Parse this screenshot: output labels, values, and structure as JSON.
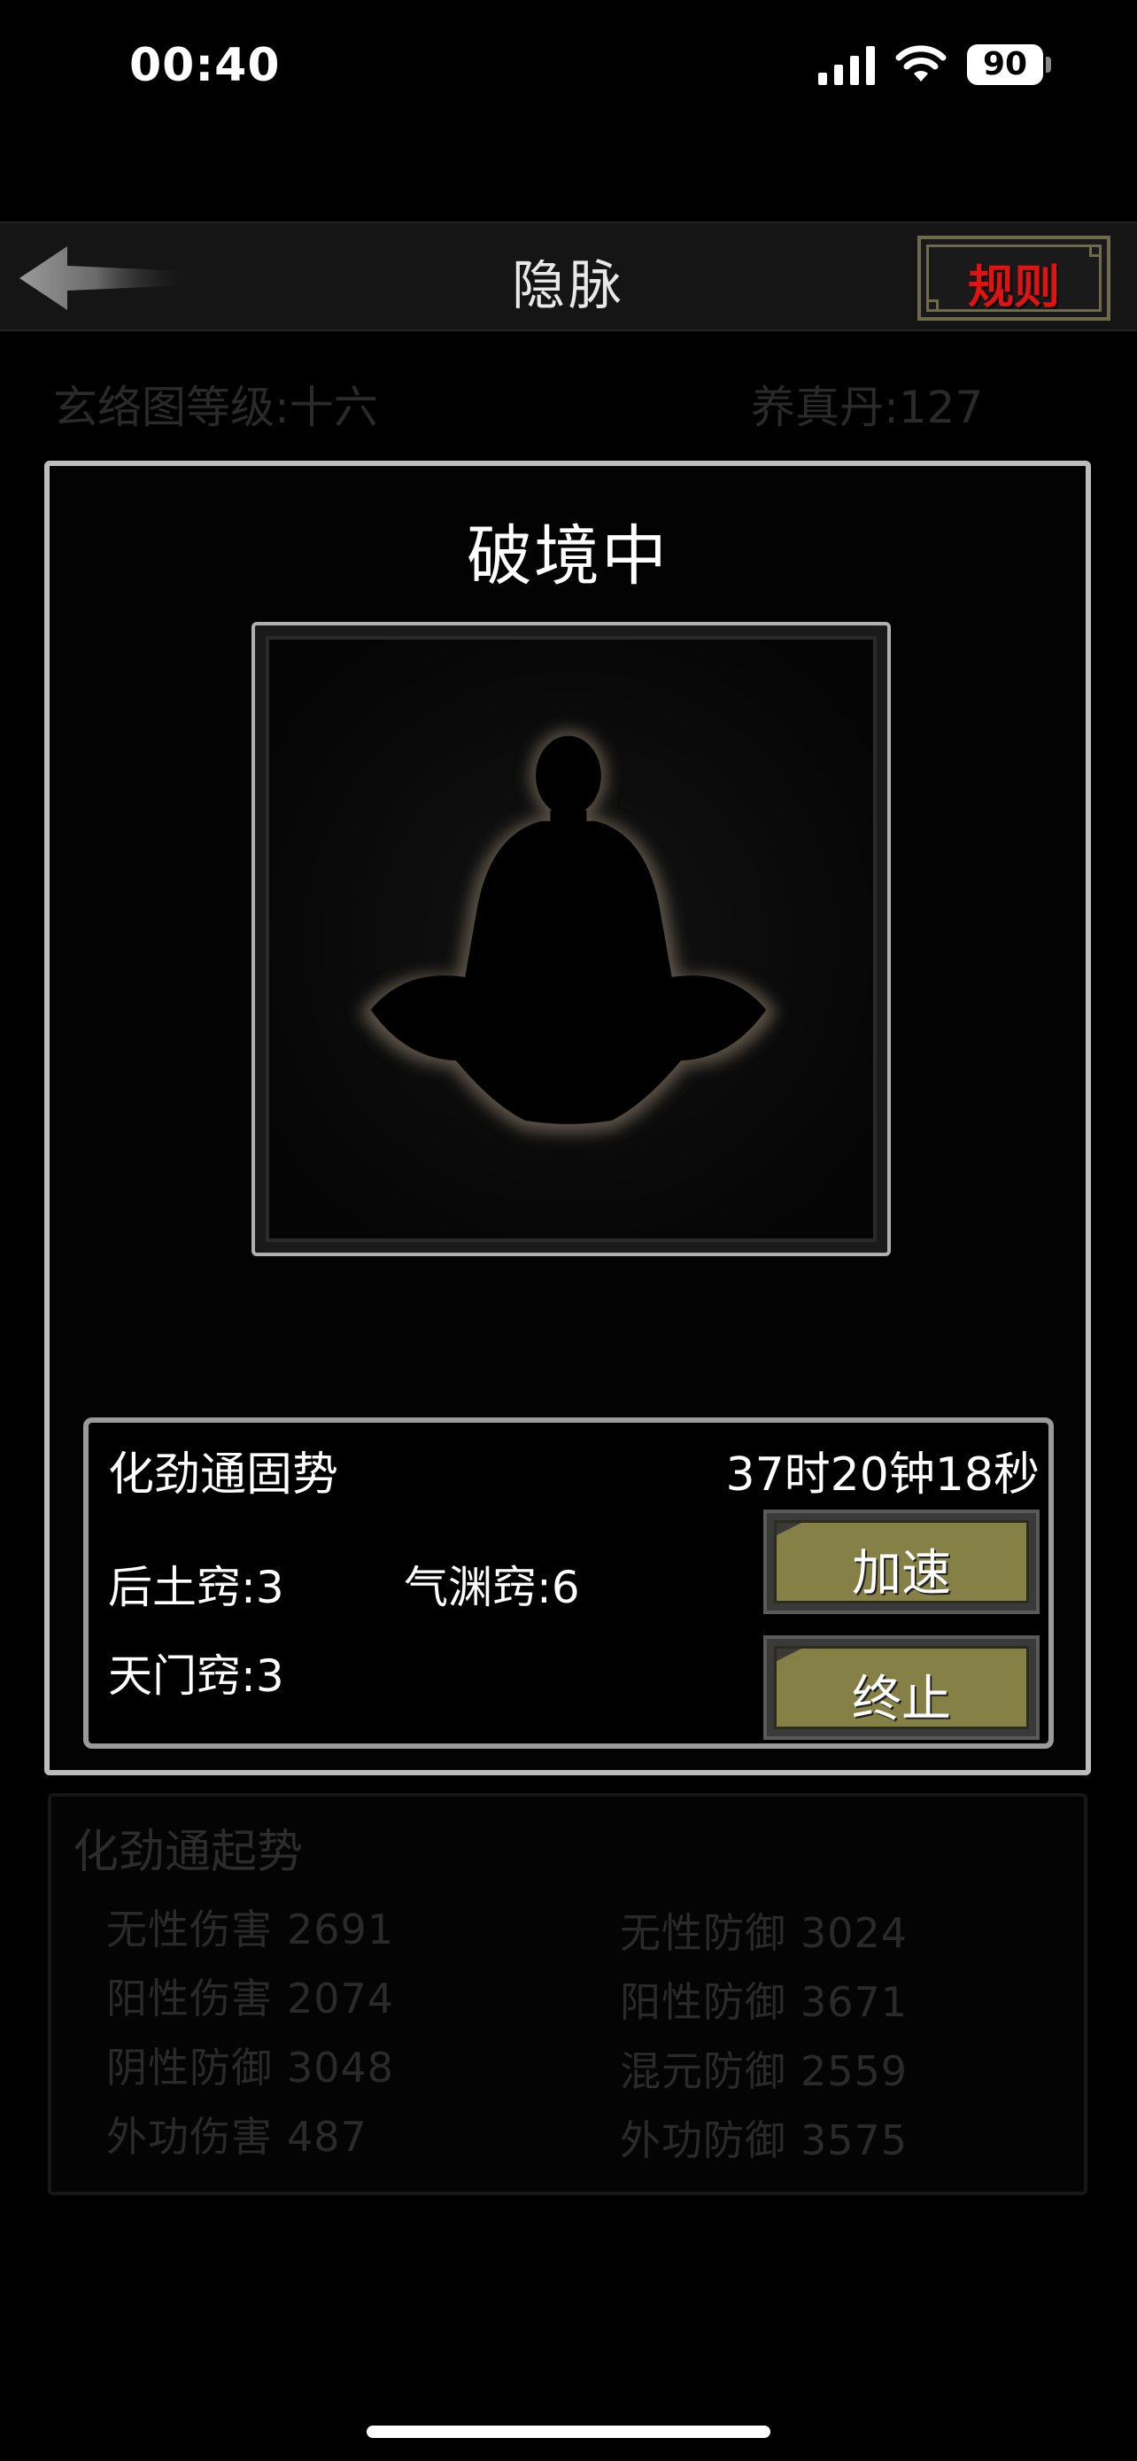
{
  "status_bar": {
    "time": "00:40",
    "battery": "90"
  },
  "header": {
    "title": "隐脉",
    "rules_label": "规则"
  },
  "info": {
    "level": "玄络图等级:十六",
    "pill": "养真丹:127"
  },
  "main": {
    "title": "破境中",
    "status_box": {
      "skill_name": "化劲通固势",
      "countdown": "37时20钟18秒",
      "acupoints": [
        "后土窍:3",
        "气渊窍:6",
        "天门窍:3"
      ],
      "speed_label": "加速",
      "stop_label": "终止"
    }
  },
  "stats": {
    "title": "化劲通起势",
    "left": [
      {
        "label": "无性伤害",
        "value": "2691"
      },
      {
        "label": "阳性伤害",
        "value": "2074"
      },
      {
        "label": "阴性防御",
        "value": "3048"
      },
      {
        "label": "外功伤害",
        "value": "487"
      }
    ],
    "right": [
      {
        "label": "无性防御",
        "value": "3024"
      },
      {
        "label": "阳性防御",
        "value": "3671"
      },
      {
        "label": "混元防御",
        "value": "2559"
      },
      {
        "label": "外功防御",
        "value": "3575"
      }
    ]
  },
  "colors": {
    "rules_red": "#e01212",
    "button_olive": "#858046",
    "frame_gold": "#6d6a4e"
  },
  "icons": [
    "signal-icon",
    "wifi-icon",
    "battery-icon",
    "back-arrow-icon",
    "meditation-figure-icon"
  ]
}
